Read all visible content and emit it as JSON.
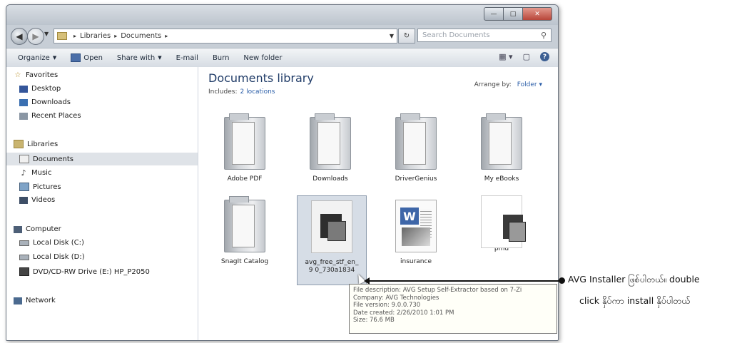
{
  "window": {
    "caption_buttons": [
      "minimize",
      "maximize",
      "close"
    ]
  },
  "address": {
    "segments": [
      "Libraries",
      "Documents"
    ],
    "search_placeholder": "Search Documents"
  },
  "toolbar": {
    "organize": "Organize",
    "open": "Open",
    "share_with": "Share with",
    "email": "E-mail",
    "burn": "Burn",
    "new_folder": "New folder"
  },
  "nav": {
    "favorites": "Favorites",
    "desktop": "Desktop",
    "downloads": "Downloads",
    "recent_places": "Recent Places",
    "libraries": "Libraries",
    "documents": "Documents",
    "music": "Music",
    "pictures": "Pictures",
    "videos": "Videos",
    "computer": "Computer",
    "local_c": "Local Disk (C:)",
    "local_d": "Local Disk (D:)",
    "dvd": "DVD/CD-RW Drive (E:) HP_P2050",
    "network": "Network"
  },
  "content": {
    "title": "Documents library",
    "includes": "Includes:",
    "locations": "2 locations",
    "arrange_by": "Arrange by:",
    "arrange_value": "Folder"
  },
  "files": [
    {
      "name": "Adobe PDF",
      "type": "folder"
    },
    {
      "name": "Downloads",
      "type": "folder"
    },
    {
      "name": "DriverGenius",
      "type": "folder"
    },
    {
      "name": "My eBooks",
      "type": "folder"
    },
    {
      "name": "SnagIt Catalog",
      "type": "folder"
    },
    {
      "name": "avg_free_stf_en_9 0_730a1834",
      "type": "exe"
    },
    {
      "name": "insurance",
      "type": "doc"
    },
    {
      "name": "pmd",
      "type": "image"
    }
  ],
  "tooltip": {
    "description": "File description: AVG Setup Self-Extractor based on 7-Zi",
    "company": "Company: AVG Technologies",
    "version": "File version: 9.0.0.730",
    "created": "Date created: 2/26/2010 1:01 PM",
    "size": "Size: 76.6 MB"
  },
  "annotation": {
    "line1": "AVG Installer ဖြစ်ပါတယ်။ double",
    "line2": "click နှိပ်ကာ install နှိပ်ပါတယ်"
  }
}
